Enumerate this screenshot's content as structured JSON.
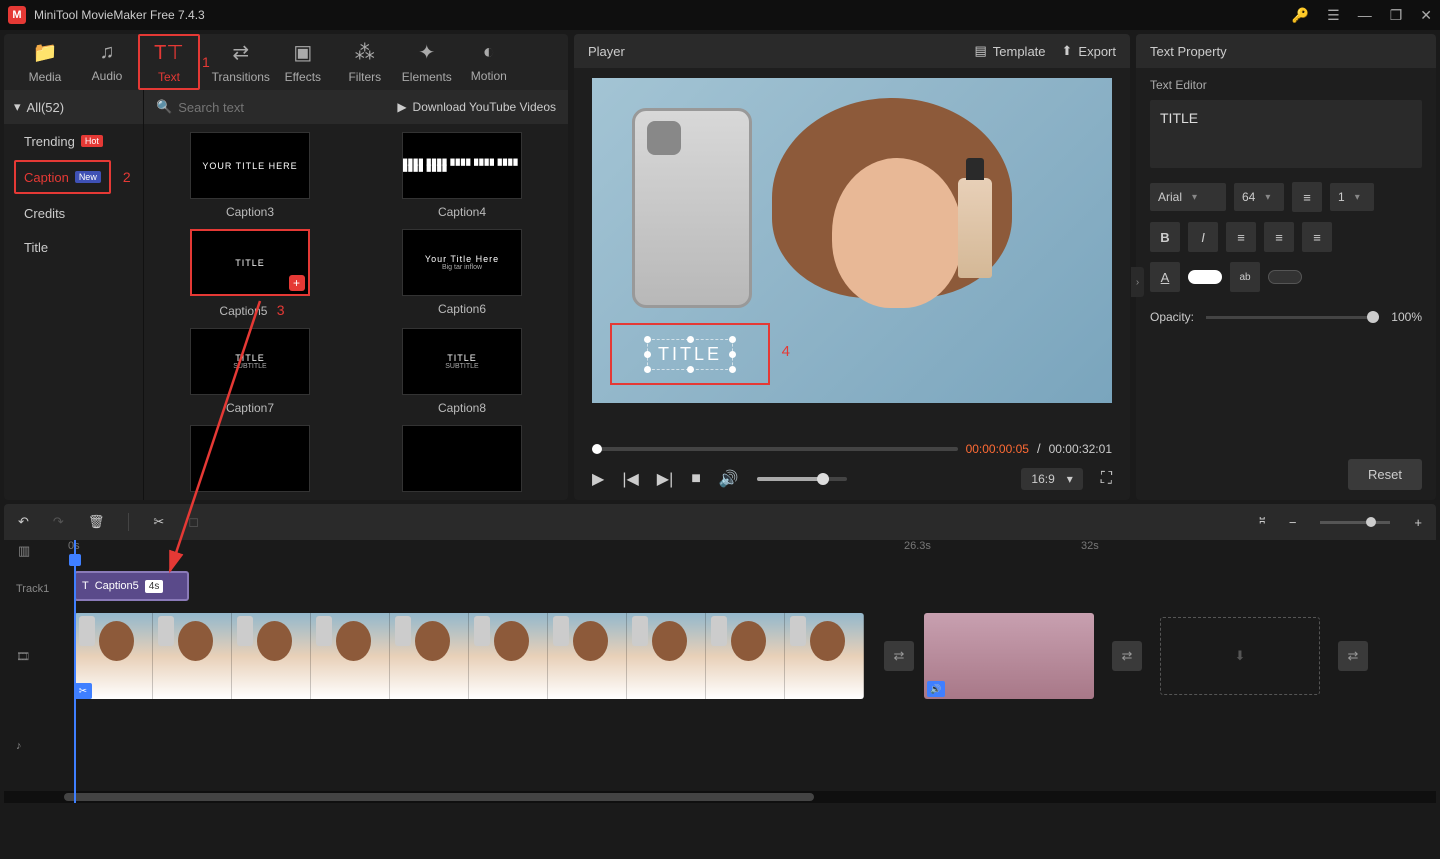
{
  "titlebar": {
    "title": "MiniTool MovieMaker Free 7.4.3"
  },
  "assetTabs": [
    {
      "id": "media",
      "label": "Media"
    },
    {
      "id": "audio",
      "label": "Audio"
    },
    {
      "id": "text",
      "label": "Text"
    },
    {
      "id": "transitions",
      "label": "Transitions"
    },
    {
      "id": "effects",
      "label": "Effects"
    },
    {
      "id": "filters",
      "label": "Filters"
    },
    {
      "id": "elements",
      "label": "Elements"
    },
    {
      "id": "motion",
      "label": "Motion"
    }
  ],
  "steps": {
    "one": "1",
    "two": "2",
    "three": "3",
    "four": "4"
  },
  "sidebar": {
    "all": "All(52)",
    "items": [
      {
        "label": "Trending",
        "badge": "Hot",
        "badgeClass": "hot"
      },
      {
        "label": "Caption",
        "badge": "New",
        "badgeClass": "new",
        "active": true
      },
      {
        "label": "Credits"
      },
      {
        "label": "Title"
      }
    ]
  },
  "search": {
    "placeholder": "Search text",
    "download": "Download YouTube Videos"
  },
  "thumbs": [
    {
      "label": "Caption3",
      "line1": "YOUR TITLE HERE"
    },
    {
      "label": "Caption4",
      "line1": "████ ████ ████ ████ ████ ████ ████"
    },
    {
      "label": "Caption5",
      "line1": "TITLE",
      "selected": true,
      "plus": true
    },
    {
      "label": "Caption6",
      "line1": "Your Title Here",
      "line2": "Big tar inflow"
    },
    {
      "label": "Caption7",
      "line1": "TITLE",
      "line2": "SUBTITLE"
    },
    {
      "label": "Caption8",
      "line1": "TITLE",
      "line2": "SUBTITLE"
    }
  ],
  "player": {
    "label": "Player",
    "template": "Template",
    "export": "Export",
    "overlayText": "TITLE",
    "currentTime": "00:00:00:05",
    "sep": "/",
    "totalTime": "00:00:32:01",
    "ratio": "16:9"
  },
  "props": {
    "title": "Text Property",
    "editor": "Text Editor",
    "content": "TITLE",
    "font": "Arial",
    "size": "64",
    "spacing": "1",
    "opacityLabel": "Opacity:",
    "opacityValue": "100%",
    "reset": "Reset"
  },
  "timeline": {
    "ruler": [
      {
        "pos": 64,
        "t": "0s"
      },
      {
        "pos": 900,
        "t": "26.3s"
      },
      {
        "pos": 1077,
        "t": "32s"
      }
    ],
    "track1": "Track1",
    "clipName": "Caption5",
    "clipDur": "4s"
  }
}
